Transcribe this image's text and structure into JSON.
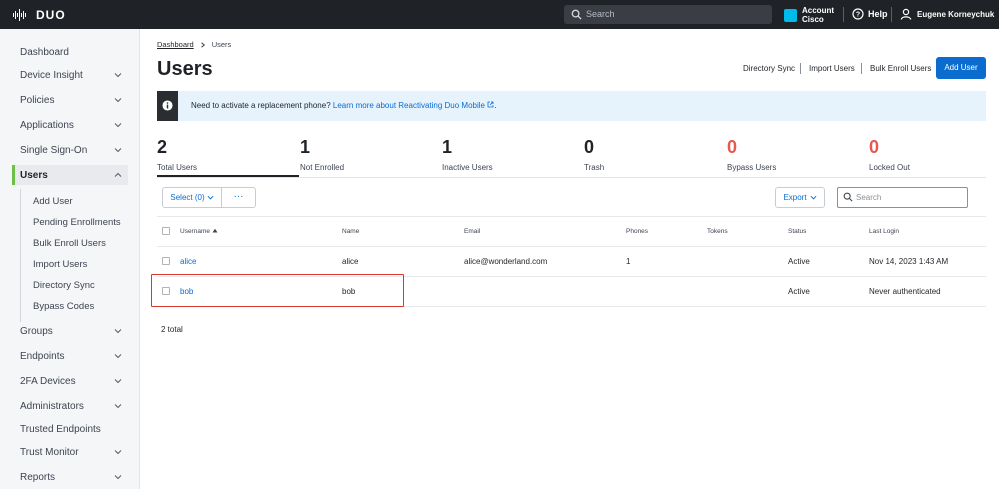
{
  "topbar": {
    "logo_text": "DUO",
    "search_placeholder": "Search",
    "account_line1": "Account",
    "account_line2": "Cisco",
    "help_label": "Help",
    "user_name": "Eugene Korneychuk"
  },
  "sidebar": {
    "items": [
      {
        "label": "Dashboard"
      },
      {
        "label": "Device Insight"
      },
      {
        "label": "Policies"
      },
      {
        "label": "Applications"
      },
      {
        "label": "Single Sign-On"
      },
      {
        "label": "Users"
      },
      {
        "label": "Groups"
      },
      {
        "label": "Endpoints"
      },
      {
        "label": "2FA Devices"
      },
      {
        "label": "Administrators"
      },
      {
        "label": "Trusted Endpoints"
      },
      {
        "label": "Trust Monitor"
      },
      {
        "label": "Reports"
      }
    ],
    "user_subitems": [
      {
        "label": "Add User"
      },
      {
        "label": "Pending Enrollments"
      },
      {
        "label": "Bulk Enroll Users"
      },
      {
        "label": "Import Users"
      },
      {
        "label": "Directory Sync"
      },
      {
        "label": "Bypass Codes"
      }
    ]
  },
  "breadcrumb": {
    "parent": "Dashboard",
    "current": "Users"
  },
  "page": {
    "title": "Users",
    "actions": {
      "directory_sync": "Directory Sync",
      "import_users": "Import Users",
      "bulk_enroll": "Bulk Enroll Users",
      "add_user": "Add User"
    }
  },
  "banner": {
    "text": "Need to activate a replacement phone?",
    "link_text": "Learn more about Reactivating Duo Mobile",
    "suffix": "."
  },
  "stats": [
    {
      "value": "2",
      "label": "Total Users",
      "color": "#1f2328"
    },
    {
      "value": "1",
      "label": "Not Enrolled",
      "color": "#1f2328"
    },
    {
      "value": "1",
      "label": "Inactive Users",
      "color": "#1f2328"
    },
    {
      "value": "0",
      "label": "Trash",
      "color": "#1f2328"
    },
    {
      "value": "0",
      "label": "Bypass Users",
      "color": "#e5594f"
    },
    {
      "value": "0",
      "label": "Locked Out",
      "color": "#e5594f"
    }
  ],
  "toolbar": {
    "select_label": "Select (0)",
    "more_label": "···",
    "export_label": "Export",
    "search_placeholder": "Search"
  },
  "table": {
    "columns": [
      "Username",
      "Name",
      "Email",
      "Phones",
      "Tokens",
      "Status",
      "Last Login"
    ],
    "rows": [
      {
        "username": "alice",
        "name": "alice",
        "email": "alice@wonderland.com",
        "phones": "1",
        "tokens": "",
        "status": "Active",
        "last_login": "Nov 14, 2023 1:43 AM"
      },
      {
        "username": "bob",
        "name": "bob",
        "email": "",
        "phones": "",
        "tokens": "",
        "status": "Active",
        "last_login": "Never authenticated"
      }
    ],
    "total_text": "2 total"
  },
  "colors": {
    "accent": "#0a6ccf",
    "topbar": "#1f2226",
    "danger": "#e5594f",
    "highlight": "#d63a2f",
    "active_nav": "#6cc04a"
  }
}
